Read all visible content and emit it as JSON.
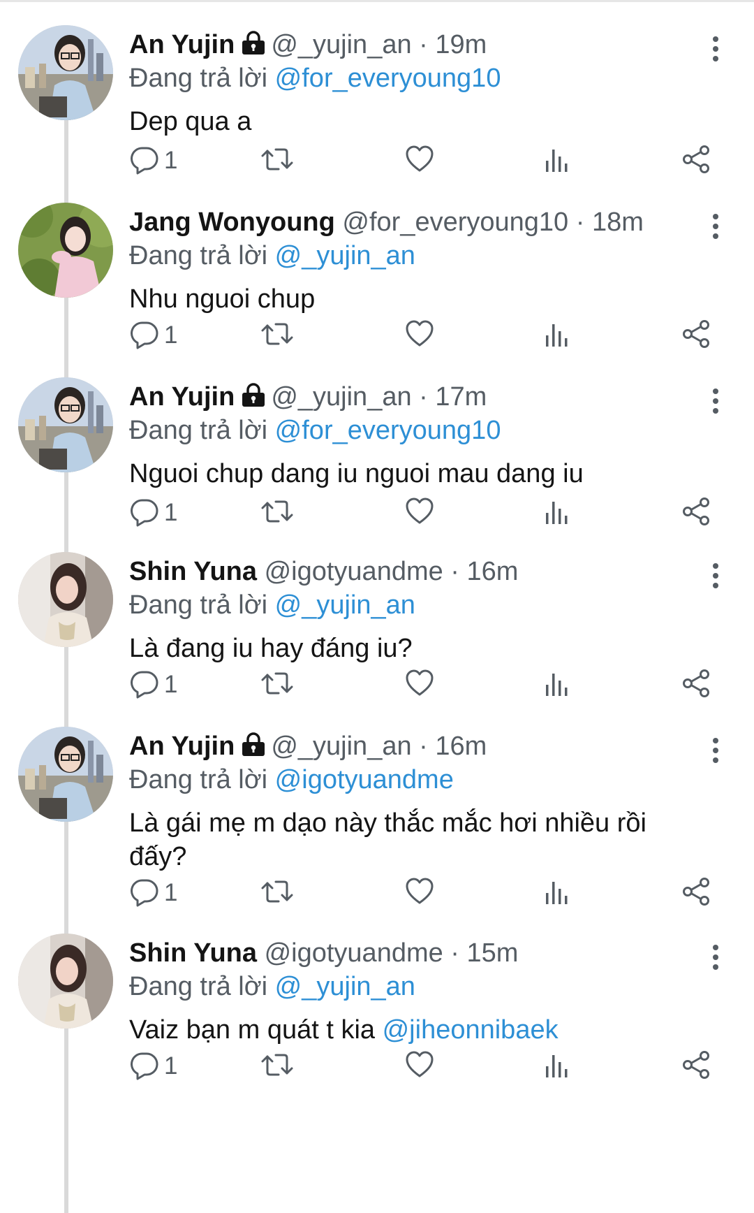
{
  "tweets": [
    {
      "name": "An Yujin",
      "locked": true,
      "handle": "@_yujin_an",
      "time": "19m",
      "reply_prefix": "Đang trả lời",
      "reply_to": "@for_everyoung10",
      "text": "Dep qua a",
      "mention": "",
      "replies": "1",
      "avatar": "yujin"
    },
    {
      "name": "Jang Wonyoung",
      "locked": false,
      "handle": "@for_everyoung10",
      "time": "18m",
      "reply_prefix": "Đang trả lời",
      "reply_to": "@_yujin_an",
      "text": "Nhu nguoi chup",
      "mention": "",
      "replies": "1",
      "avatar": "wonyoung"
    },
    {
      "name": "An Yujin",
      "locked": true,
      "handle": "@_yujin_an",
      "time": "17m",
      "reply_prefix": "Đang trả lời",
      "reply_to": "@for_everyoung10",
      "text": "Nguoi chup dang iu nguoi mau dang iu",
      "mention": "",
      "replies": "1",
      "avatar": "yujin"
    },
    {
      "name": "Shin Yuna",
      "locked": false,
      "handle": "@igotyuandme",
      "time": "16m",
      "reply_prefix": "Đang trả lời",
      "reply_to": "@_yujin_an",
      "text": "Là đang iu hay đáng iu?",
      "mention": "",
      "replies": "1",
      "avatar": "yuna"
    },
    {
      "name": "An Yujin",
      "locked": true,
      "handle": "@_yujin_an",
      "time": "16m",
      "reply_prefix": "Đang trả lời",
      "reply_to": "@igotyuandme",
      "text": "Là gái mẹ m dạo này thắc mắc hơi nhiều rồi đấy?",
      "mention": "",
      "replies": "1",
      "avatar": "yujin"
    },
    {
      "name": "Shin Yuna",
      "locked": false,
      "handle": "@igotyuandme",
      "time": "15m",
      "reply_prefix": "Đang trả lời",
      "reply_to": "@_yujin_an",
      "text": "Vaiz bạn m quát t kia",
      "mention": "@jiheonnibaek",
      "replies": "1",
      "avatar": "yuna"
    }
  ],
  "colors": {
    "link": "#2d8fd5",
    "muted": "#555c63",
    "text": "#141414",
    "thread": "#d9d9d9"
  },
  "icons": [
    "reply-icon",
    "retweet-icon",
    "like-icon",
    "views-icon",
    "share-icon",
    "more-icon",
    "lock-icon"
  ]
}
